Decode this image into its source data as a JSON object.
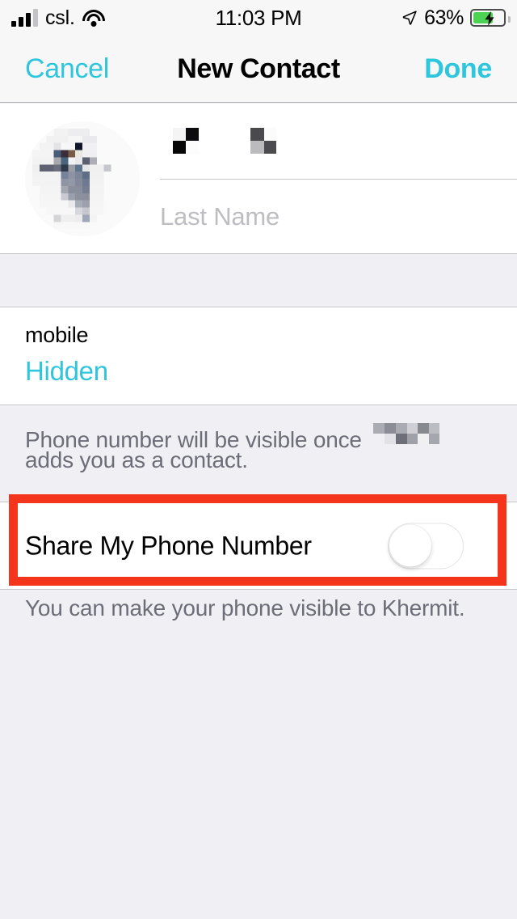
{
  "status_bar": {
    "carrier": "csl.",
    "time": "11:03 PM",
    "battery_percent": "63%",
    "signal_bars_filled": 3,
    "signal_bars_total": 4,
    "battery_level": 63,
    "charging": true,
    "icons": {
      "signal": "signal-bars-icon",
      "wifi": "wifi-icon",
      "location": "location-arrow-icon",
      "battery": "battery-charging-icon"
    }
  },
  "nav_bar": {
    "cancel_label": "Cancel",
    "title": "New Contact",
    "done_label": "Done"
  },
  "name_card": {
    "avatar_alt": "contact-photo",
    "first_name_value": "",
    "first_name_redacted": true,
    "last_name_placeholder": "Last Name",
    "last_name_value": ""
  },
  "phone_section": {
    "label": "mobile",
    "value": "Hidden"
  },
  "note_visibility": {
    "line1": "Phone number will be visible once",
    "line1_redacted_name": true,
    "line2": "adds you as a contact."
  },
  "share_row": {
    "label": "Share My Phone Number",
    "toggle_on": false,
    "toggle_state_text": "off"
  },
  "note_share": {
    "text": "You can make your phone visible to Khermit."
  },
  "annotation": {
    "highlight_color": "#F4351B",
    "highlight_target": "share-my-phone-number-row"
  },
  "colors": {
    "accent": "#2EC6DC",
    "background": "#EFEFF4",
    "card": "#FFFFFF",
    "separator": "#C8C7CC",
    "secondary_text": "#6D6D78",
    "battery_green": "#4CD353"
  }
}
